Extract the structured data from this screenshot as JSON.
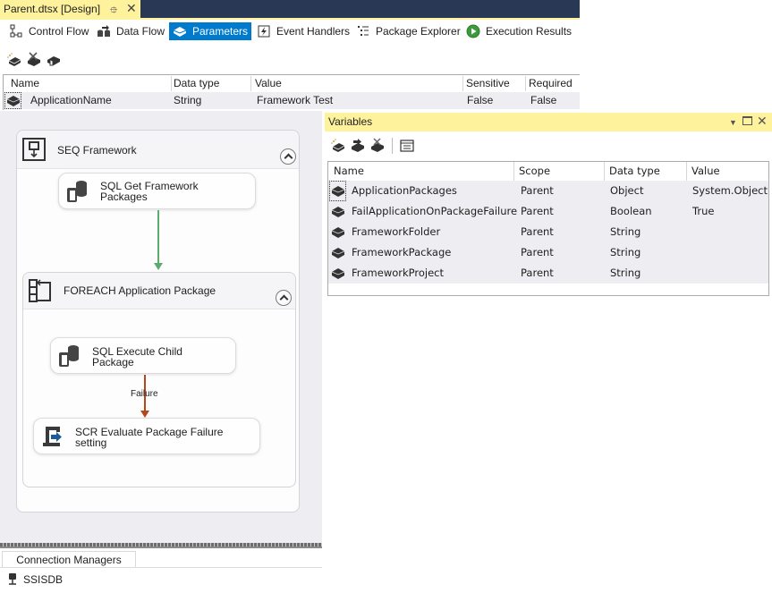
{
  "document_tab": {
    "title": "Parent.dtsx [Design]",
    "pin_icon": "pin-icon",
    "close_icon": "close-icon"
  },
  "designer_tabs": [
    {
      "label": "Control Flow",
      "icon": "control-flow-icon",
      "active": false
    },
    {
      "label": "Data Flow",
      "icon": "data-flow-icon",
      "active": false
    },
    {
      "label": "Parameters",
      "icon": "parameter-icon",
      "active": true
    },
    {
      "label": "Event Handlers",
      "icon": "event-handler-icon",
      "active": false
    },
    {
      "label": "Package Explorer",
      "icon": "package-explorer-icon",
      "active": false
    },
    {
      "label": "Execution Results",
      "icon": "execution-results-icon",
      "active": false
    }
  ],
  "params_toolbar": {
    "buttons": [
      "add-parameter-icon",
      "delete-parameter-icon",
      "add-to-config-icon"
    ]
  },
  "parameters": {
    "columns": [
      "Name",
      "Data type",
      "Value",
      "Sensitive",
      "Required"
    ],
    "rows": [
      {
        "name": "ApplicationName",
        "data_type": "String",
        "value": "Framework Test",
        "sensitive": "False",
        "required": "False"
      }
    ]
  },
  "control_flow": {
    "sequence": {
      "title": "SEQ Framework",
      "tasks": [
        {
          "label_line1": "SQL Get Framework",
          "label_line2": "Packages"
        }
      ]
    },
    "foreach": {
      "title": "FOREACH Application Package",
      "tasks": [
        {
          "label_line1": "SQL Execute Child",
          "label_line2": "Package"
        },
        {
          "label_line1": "SCR Evaluate Package Failure",
          "label_line2": "setting"
        }
      ],
      "constraint_label": "Failure"
    },
    "colors": {
      "success": "#5aad6e",
      "failure": "#b5481a"
    }
  },
  "connection_managers": {
    "tab_label": "Connection Managers",
    "items": [
      "SSISDB"
    ]
  },
  "variables_panel": {
    "title": "Variables",
    "toolbar": [
      "add-variable-icon",
      "move-variable-icon",
      "delete-variable-icon",
      "grid-options-icon"
    ],
    "columns": [
      "Name",
      "Scope",
      "Data type",
      "Value"
    ],
    "rows": [
      {
        "name": "ApplicationPackages",
        "scope": "Parent",
        "data_type": "Object",
        "value": "System.Object"
      },
      {
        "name": "FailApplicationOnPackageFailure",
        "scope": "Parent",
        "data_type": "Boolean",
        "value": "True"
      },
      {
        "name": "FrameworkFolder",
        "scope": "Parent",
        "data_type": "String",
        "value": ""
      },
      {
        "name": "FrameworkPackage",
        "scope": "Parent",
        "data_type": "String",
        "value": ""
      },
      {
        "name": "FrameworkProject",
        "scope": "Parent",
        "data_type": "String",
        "value": ""
      }
    ]
  },
  "theme": {
    "active_tab": "#007acc",
    "tool_window_title": "#fff29d",
    "doc_strip": "#293955"
  }
}
